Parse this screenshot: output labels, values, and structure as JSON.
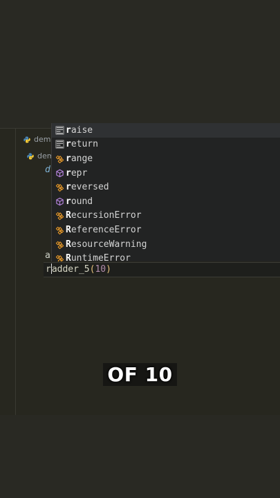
{
  "explorer": {
    "items": [
      {
        "label": "demo",
        "icon": "python-file-icon"
      },
      {
        "label": "dem",
        "icon": "python-file-icon"
      }
    ]
  },
  "code": {
    "fragment_def": "d",
    "fragment_a": "a",
    "current_line": {
      "before_caret": "r",
      "after_caret": "adder_5",
      "open_paren": "(",
      "argument": "10",
      "close_paren": ")"
    }
  },
  "autocomplete": {
    "typed_prefix": "r",
    "items": [
      {
        "label": "raise",
        "kind": "keyword",
        "icon": "keyword-icon"
      },
      {
        "label": "return",
        "kind": "keyword",
        "icon": "keyword-icon"
      },
      {
        "label": "range",
        "kind": "class",
        "icon": "class-icon"
      },
      {
        "label": "repr",
        "kind": "function",
        "icon": "method-cube-icon"
      },
      {
        "label": "reversed",
        "kind": "class",
        "icon": "class-icon"
      },
      {
        "label": "round",
        "kind": "function",
        "icon": "method-cube-icon"
      },
      {
        "label": "RecursionError",
        "kind": "class",
        "icon": "class-icon"
      },
      {
        "label": "ReferenceError",
        "kind": "class",
        "icon": "class-icon"
      },
      {
        "label": "ResourceWarning",
        "kind": "class",
        "icon": "class-icon"
      },
      {
        "label": "RuntimeError",
        "kind": "class",
        "icon": "class-icon"
      }
    ]
  },
  "caption": {
    "text": "OF 10"
  },
  "colors": {
    "keyword_icon": "#c5c5c5",
    "class_icon": "#ee9d28",
    "function_icon": "#b180d7",
    "python_icon_blue": "#4b8bbe",
    "python_icon_yellow": "#ffd43b"
  }
}
